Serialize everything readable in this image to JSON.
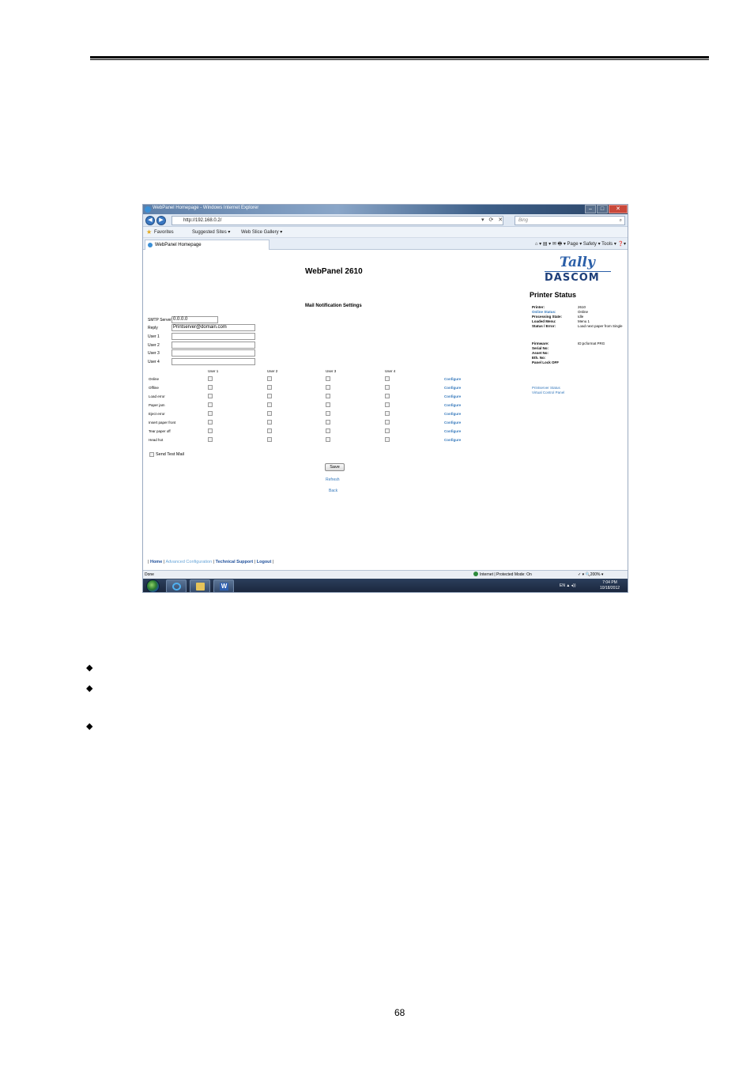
{
  "browser": {
    "title": "WebPanel Homepage - Windows Internet Explorer",
    "address": "http://192.168.0.2/",
    "search_placeholder": "Bing",
    "favorites": "Favorites",
    "suggested_sites": "Suggested Sites ▾",
    "web_slice": "Web Slice Gallery ▾",
    "tab_title": "WebPanel Homepage",
    "command_bar": "⌂ ▾ ▤ ▾ ✉ 🖶 ▾ Page ▾ Safety ▾ Tools ▾ ❓▾"
  },
  "page": {
    "title": "WebPanel 2610",
    "section_title": "Mail Notification Settings",
    "logo": {
      "tally": "Tally",
      "dascom": "DASCOM"
    }
  },
  "form": {
    "smtp_label": "SMTP Server",
    "smtp_value": "0.0.0.0",
    "reply_label": "Reply",
    "reply_value": "Printserver@domain.com",
    "user_labels": [
      "User 1",
      "User 2",
      "User 3",
      "User 4"
    ]
  },
  "grid": {
    "columns": [
      "User 1",
      "User 2",
      "User 3",
      "User 4"
    ],
    "events": [
      "Online",
      "Offline",
      "Load error",
      "Paper jam",
      "Eject error",
      "Insert paper front",
      "Tear paper off",
      "Head hot"
    ],
    "configure_label": "Configure"
  },
  "send_test_mail": "Send Test Mail",
  "save_label": "Save",
  "refresh_label": "Refresh",
  "back_label": "Back",
  "status": {
    "title": "Printer Status",
    "rows": [
      {
        "key": "Printer:",
        "value": "2610"
      },
      {
        "key": "Online Status:",
        "value": "Online"
      },
      {
        "key": "Processing State:",
        "value": "Idle"
      },
      {
        "key": "Loaded Menu:",
        "value": "Menu 1"
      },
      {
        "key": "Status / Error:",
        "value": "Load next paper from Single"
      },
      {
        "key": "Firmware:",
        "value": "ID:pcformat PRG"
      },
      {
        "key": "Serial No:",
        "value": ""
      },
      {
        "key": "Asset No:",
        "value": ""
      },
      {
        "key": "Eth. No:",
        "value": ""
      },
      {
        "key": "Panel Lock OFF",
        "value": ""
      }
    ],
    "link1": "Printserver Status",
    "link2": "Virtual Control Panel"
  },
  "footer": {
    "home": "Home",
    "advanced": "Advanced Configuration",
    "support": "Technical Support",
    "logout": "Logout"
  },
  "statusbar": {
    "left": "Done",
    "middle": "Internet | Protected Mode: On",
    "zoom": "✓ ▾  🔍200% ▾"
  },
  "taskbar": {
    "lang": "EN  ▲  ◂))",
    "time": "7:04 PM",
    "date": "10/18/2012"
  },
  "document": {
    "page_number": "68",
    "bullet": "◆"
  }
}
